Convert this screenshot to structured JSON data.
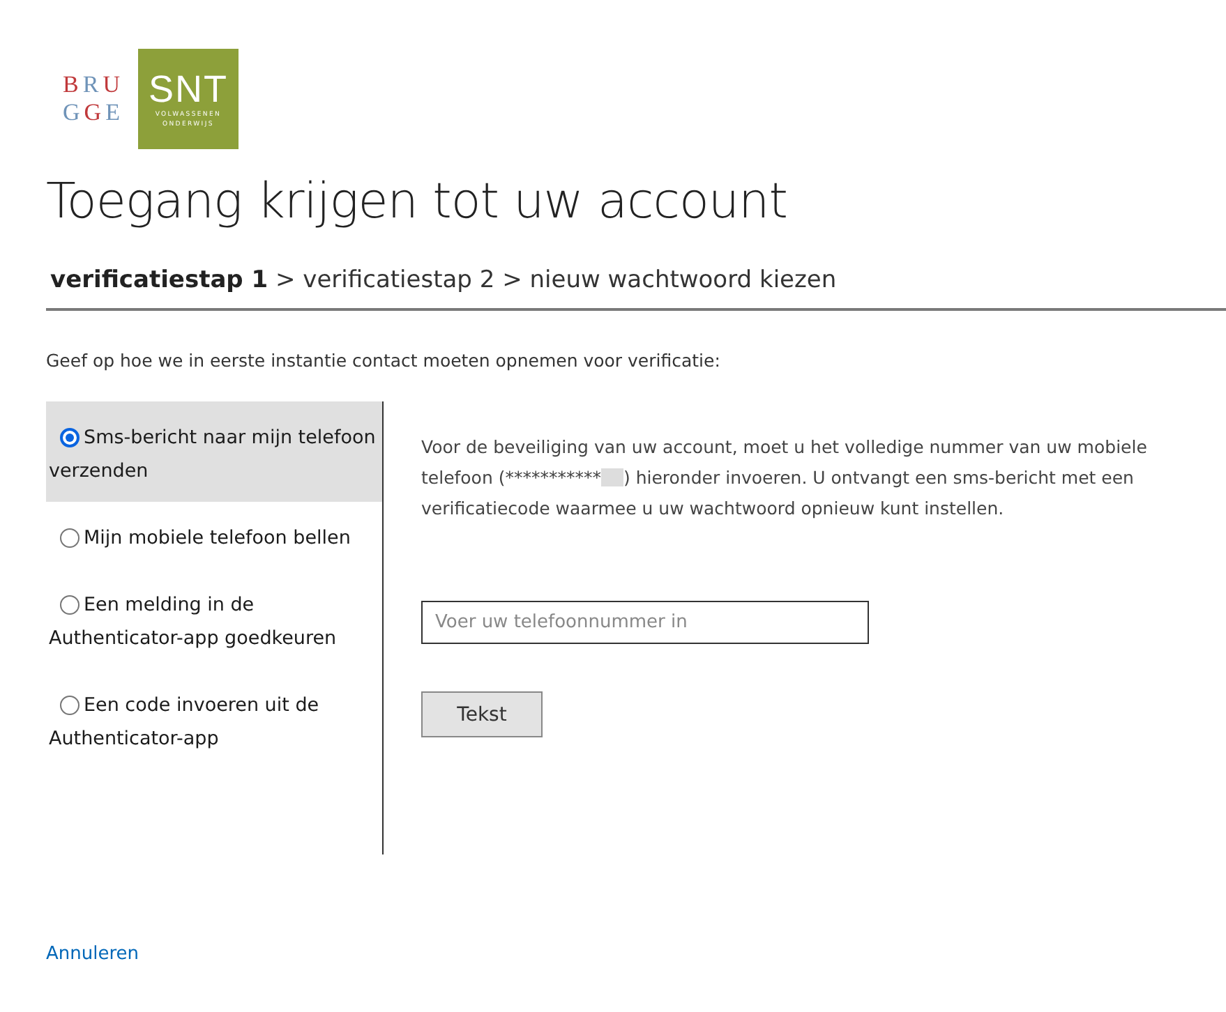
{
  "logo": {
    "city_lines": [
      "BRU",
      "GGE"
    ],
    "brand": "SNT",
    "brand_lines": [
      "VOLWASSENEN",
      "ONDERWIJS"
    ]
  },
  "title": "Toegang krijgen tot uw account",
  "steps": [
    {
      "label": "verificatiestap 1",
      "current": true
    },
    {
      "label": "verificatiestap 2",
      "current": false
    },
    {
      "label": "nieuw wachtwoord kiezen",
      "current": false
    }
  ],
  "step_separator": ">",
  "instruction": "Geef op hoe we in eerste instantie contact moeten opnemen voor verificatie:",
  "options": [
    {
      "label": "Sms-bericht naar mijn telefoon verzenden",
      "selected": true
    },
    {
      "label": "Mijn mobiele telefoon bellen",
      "selected": false
    },
    {
      "label": "Een melding in de Authenticator-app goedkeuren",
      "selected": false
    },
    {
      "label": "Een code invoeren uit de Authenticator-app",
      "selected": false
    }
  ],
  "description": {
    "before": "Voor de beveiliging van uw account, moet u het volledige nummer van uw mobiele telefoon (***********",
    "after": ") hieronder invoeren. U ontvangt een sms-bericht met een verificatiecode waarmee u uw wachtwoord opnieuw kunt instellen."
  },
  "phone_field": {
    "placeholder": "Voer uw telefoonnummer in"
  },
  "send_button": "Tekst",
  "cancel_link": "Annuleren"
}
